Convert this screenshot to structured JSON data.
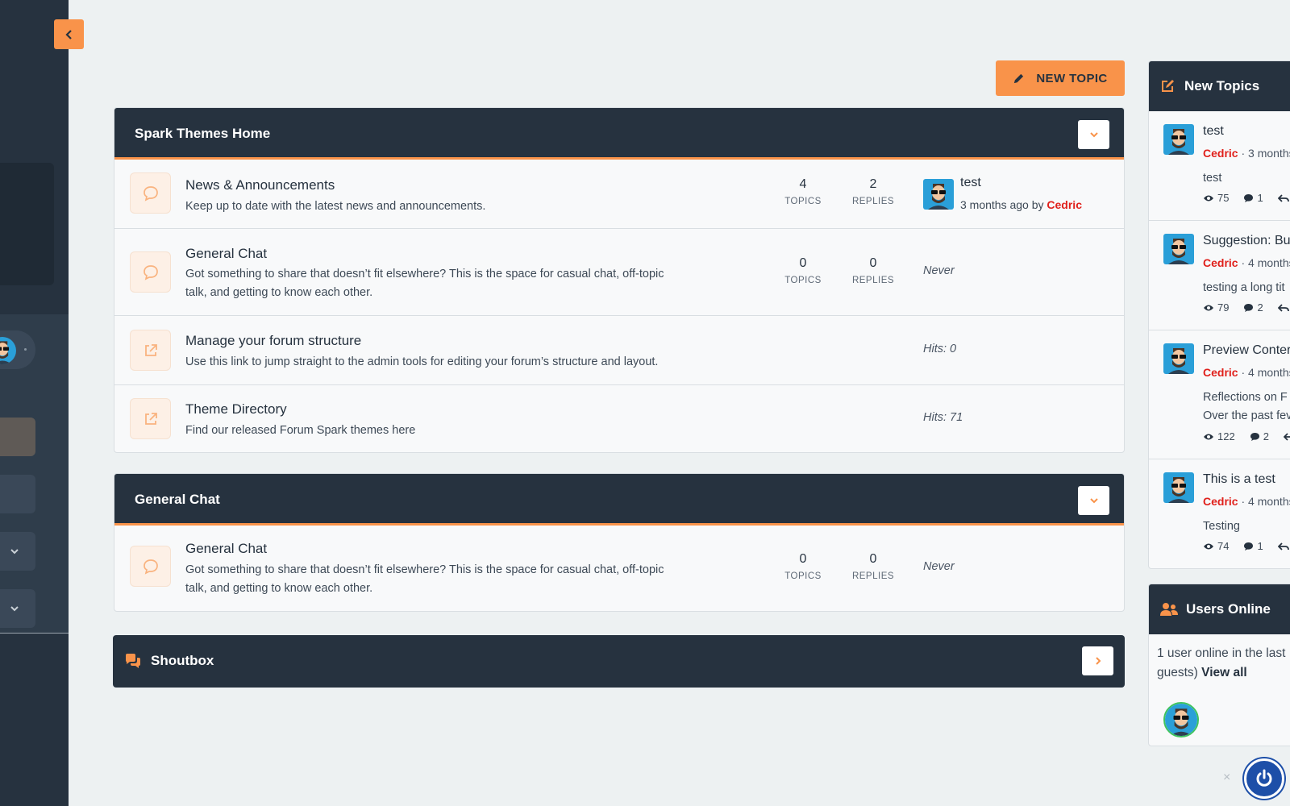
{
  "toolbar": {
    "new_topic_label": "NEW TOPIC"
  },
  "categories": [
    {
      "title": "Spark Themes Home",
      "forums": [
        {
          "title": "News & Announcements",
          "description": "Keep up to date with the latest news and announcements.",
          "topics": "4",
          "replies": "2",
          "last_title": "test",
          "last_time": "3 months ago by",
          "last_user": "Cedric"
        },
        {
          "title": "General Chat",
          "description": "Got something to share that doesn’t fit elsewhere? This is the space for casual chat, off-topic talk, and getting to know each other.",
          "topics": "0",
          "replies": "0",
          "last": "Never"
        },
        {
          "title": "Manage your forum structure",
          "description": "Use this link to jump straight to the admin tools for editing your forum’s structure and layout.",
          "hits": "Hits: 0"
        },
        {
          "title": "Theme Directory",
          "description": "Find our released Forum Spark themes here",
          "hits": "Hits: 71"
        }
      ]
    },
    {
      "title": "General Chat",
      "forums": [
        {
          "title": "General Chat",
          "description": "Got something to share that doesn’t fit elsewhere? This is the space for casual chat, off-topic talk, and getting to know each other.",
          "topics": "0",
          "replies": "0",
          "last": "Never"
        }
      ]
    }
  ],
  "labels": {
    "topics": "TOPICS",
    "replies": "REPLIES"
  },
  "shoutbox": {
    "title": "Shoutbox"
  },
  "new_topics": {
    "title": "New Topics",
    "items": [
      {
        "title": "test",
        "user": "Cedric",
        "time": "· 3 months",
        "excerpt": "test",
        "views": "75",
        "replies": "1"
      },
      {
        "title": "Suggestion: Bu",
        "user": "Cedric",
        "time": "· 4 months",
        "excerpt": "testing a long tit",
        "views": "79",
        "replies": "2"
      },
      {
        "title": "Preview Conter",
        "user": "Cedric",
        "time": "· 4 months",
        "excerpt": "Reflections on F",
        "excerpt2": "Over the past fev",
        "views": "122",
        "replies": "2"
      },
      {
        "title": "This is a test",
        "user": "Cedric",
        "time": "· 4 months",
        "excerpt": "Testing",
        "views": "74",
        "replies": "1"
      }
    ]
  },
  "users_online": {
    "title": "Users Online",
    "line1": "1 user online in the last",
    "line2": "guests)",
    "view_all": "View all"
  },
  "misc": {
    "close": "×"
  },
  "colors": {
    "accent": "#f9934a",
    "dark": "#26323f",
    "username": "#e0201b",
    "online": "#3ec35e"
  }
}
